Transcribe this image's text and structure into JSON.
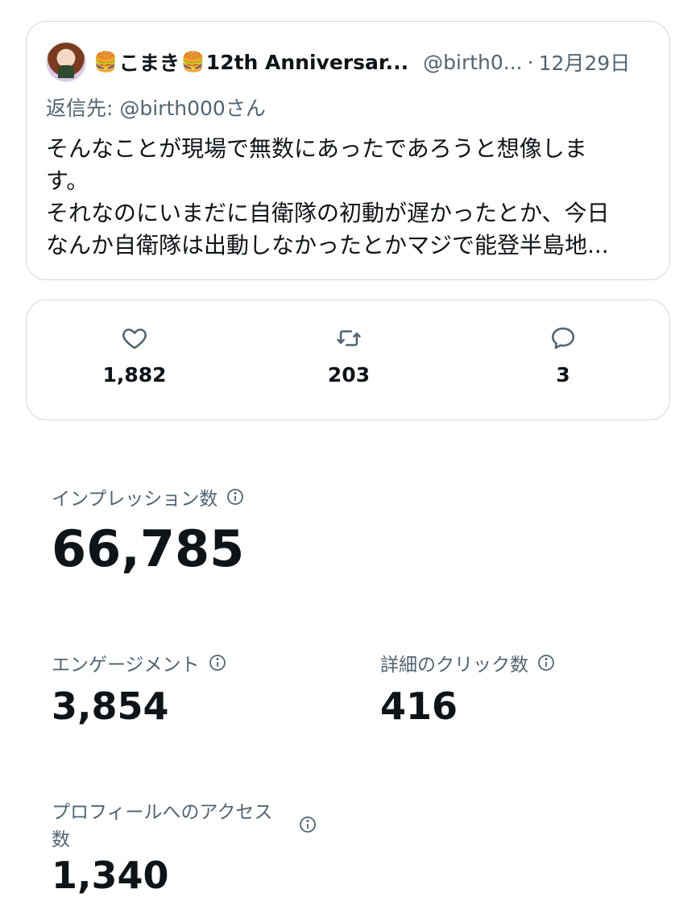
{
  "tweet": {
    "name_emoji": "🍔",
    "name_text": "こまき",
    "name_suffix": "12th Anniversar...",
    "handle": "@birth0...",
    "separator": "·",
    "date": "12月29日",
    "reply_to": "返信先: @birth000さん",
    "text": "そんなことが現場で無数にあったであろうと想像しま\nす。\nそれなのにいまだに自衛隊の初動が遅かったとか、今日\nなんか自衛隊は出動しなかったとかマジで能登半島地..."
  },
  "engagement_bar": {
    "likes": "1,882",
    "retweets": "203",
    "replies": "3"
  },
  "metrics": {
    "impressions": {
      "label": "インプレッション数",
      "value": "66,785"
    },
    "engagements": {
      "label": "エンゲージメント",
      "value": "3,854"
    },
    "detail_clicks": {
      "label": "詳細のクリック数",
      "value": "416"
    },
    "profile_visits": {
      "label": "プロフィールへのアクセス数",
      "value": "1,340"
    }
  },
  "icons": [
    "avatar",
    "heart-icon",
    "retweet-icon",
    "reply-icon",
    "info-icon"
  ],
  "colors": {
    "text": "#0f1419",
    "secondary": "#536471",
    "border": "#cfd9de"
  }
}
